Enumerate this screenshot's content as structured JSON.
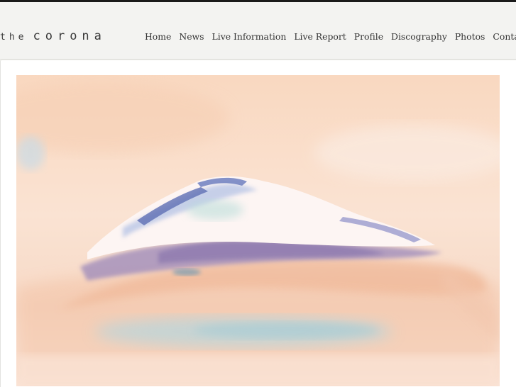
{
  "site": {
    "logo_prefix": "the",
    "logo_name": "corona"
  },
  "nav": {
    "items": [
      {
        "label": "Home"
      },
      {
        "label": "News"
      },
      {
        "label": "Live Information"
      },
      {
        "label": "Live Report"
      },
      {
        "label": "Profile"
      },
      {
        "label": "Discography"
      },
      {
        "label": "Photos"
      },
      {
        "label": "Contact"
      }
    ]
  },
  "hero": {
    "image": "watercolor-mountain-painting",
    "palette": {
      "sky": "#f9dcc6",
      "sky_light": "#fbe9dc",
      "snow": "#fdf6f2",
      "violet": "#8a7cb0",
      "blue": "#6f8fc4",
      "peach": "#f4bda0",
      "teal": "#a9d2d8"
    }
  }
}
